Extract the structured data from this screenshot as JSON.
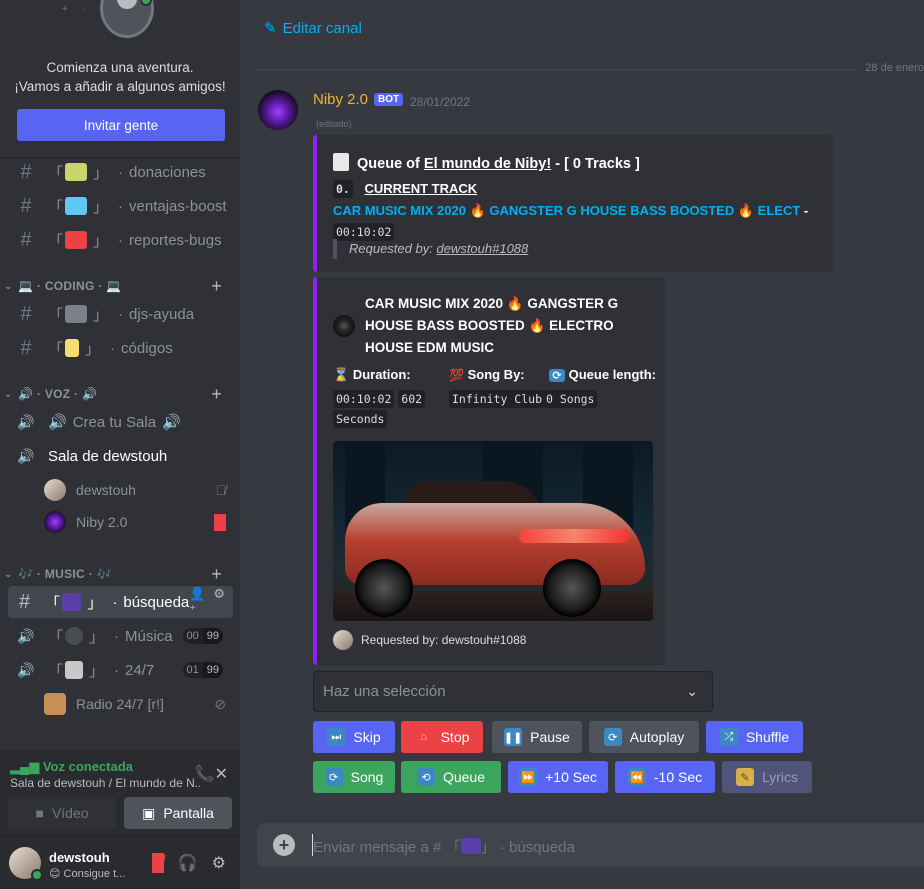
{
  "sidebar": {
    "invite": {
      "line1": "Comienza una aventura.",
      "line2": "¡Vamos a añadir a algunos amigos!",
      "button": "Invitar gente"
    },
    "channels_top": [
      {
        "name": "donaciones",
        "emoji_color": "#c9d46a"
      },
      {
        "name": "ventajas-boost",
        "emoji_color": "#5fc9f3"
      },
      {
        "name": "reportes-bugs",
        "emoji_color": "#ed4245"
      }
    ],
    "categories": {
      "coding": "CODING",
      "voz": "VOZ",
      "music": "MUSIC"
    },
    "coding_channels": [
      {
        "name": "djs-ayuda"
      },
      {
        "name": "códigos"
      }
    ],
    "voice_channels": {
      "crea": "Crea tu Sala",
      "sala": "Sala de dewstouh"
    },
    "voice_users": [
      {
        "name": "dewstouh"
      },
      {
        "name": "Niby 2.0"
      }
    ],
    "music_channels": {
      "busqueda": "búsqueda",
      "musica": "Música",
      "radio": "24/7",
      "radio_user": "Radio 24/7 [r!]",
      "musica_badge": [
        "00",
        "99"
      ],
      "radio_badge": [
        "01",
        "99"
      ]
    },
    "voice_panel": {
      "title": "Voz conectada",
      "subtitle": "Sala de dewstouh / El mundo de N...",
      "video": "Vídeo",
      "screen": "Pantalla"
    },
    "user_panel": {
      "name": "dewstouh",
      "status": "Consigue t..."
    }
  },
  "main": {
    "edit_channel": "Editar canal",
    "date_divider": "28 de enero",
    "message": {
      "author": "Niby 2.0",
      "bot_tag": "BOT",
      "time": "28/01/2022",
      "edited": "(editado)"
    },
    "embed1": {
      "title_prefix": "Queue of",
      "server": "El mundo de Niby!",
      "tracks": "[ 0 Tracks ]",
      "index": "0.",
      "current_label": "CURRENT TRACK",
      "track": "CAR MUSIC MIX 2020",
      "track_mid": "GANGSTER G HOUSE BASS BOOSTED",
      "track_end": "ELECT",
      "duration": "00:10:02",
      "requested_label": "Requested by:",
      "requester": "dewstouh#1088"
    },
    "embed2": {
      "title": "CAR MUSIC MIX 2020 🔥 GANGSTER G HOUSE BASS BOOSTED 🔥 ELECTRO HOUSE EDM MUSIC",
      "duration_label": "Duration:",
      "duration_time": "00:10:02",
      "duration_secs": "602",
      "duration_unit": "Seconds",
      "song_by_label": "Song By:",
      "song_by": "Infinity Club",
      "queue_label": "Queue length:",
      "queue": "0 Songs",
      "footer": "Requested by: dewstouh#1088"
    },
    "select_placeholder": "Haz una selección",
    "buttons_row1": [
      {
        "label": "Skip",
        "icon": "skip-icon"
      },
      {
        "label": "Stop",
        "icon": "house-icon"
      },
      {
        "label": "Pause",
        "icon": "pause-icon"
      },
      {
        "label": "Autoplay",
        "icon": "repeat-icon"
      },
      {
        "label": "Shuffle",
        "icon": "shuffle-icon"
      }
    ],
    "buttons_row2": [
      {
        "label": "Song",
        "icon": "repeat-icon"
      },
      {
        "label": "Queue",
        "icon": "repeat-one-icon"
      },
      {
        "label": "+10 Sec",
        "icon": "fast-forward-icon"
      },
      {
        "label": "-10 Sec",
        "icon": "rewind-icon"
      },
      {
        "label": "Lyrics",
        "icon": "notepad-icon"
      }
    ],
    "input_placeholder_prefix": "Enviar mensaje a #",
    "input_placeholder_channel": "búsqueda"
  },
  "colors": {
    "blurple": "#5865f2",
    "danger": "#ed4245",
    "success": "#3ba55d",
    "secondary": "#4f545c",
    "embed_accent": "#8d23f3",
    "bot_name": "#f0b232",
    "link": "#00aff4"
  }
}
